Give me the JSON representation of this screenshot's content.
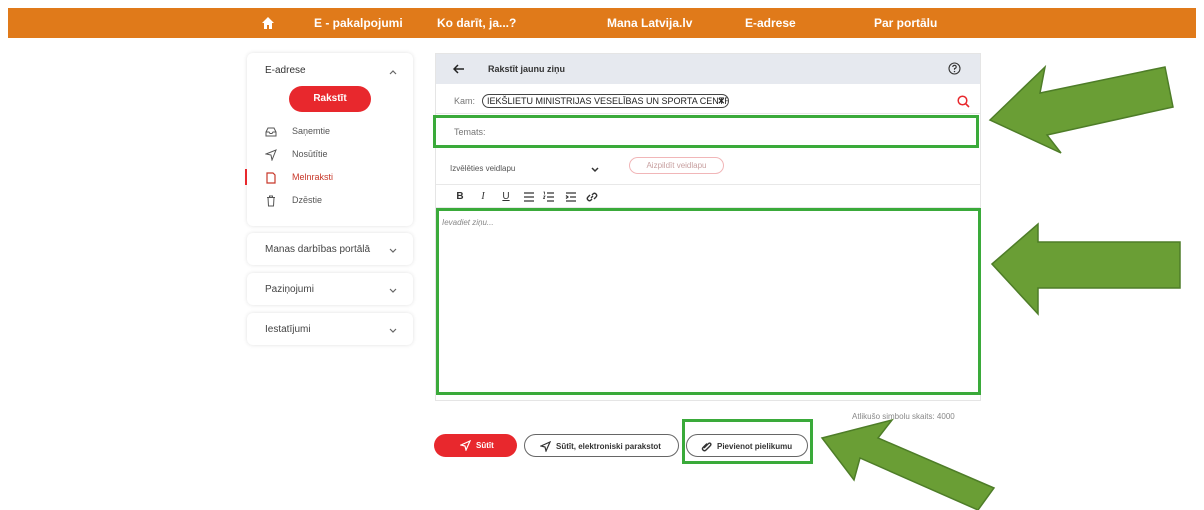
{
  "nav": {
    "home_icon": "home-icon",
    "items": [
      "E - pakalpojumi",
      "Ko darīt, ja...?",
      "Mana Latvija.lv",
      "E-adrese",
      "Par portālu"
    ]
  },
  "sidebar": {
    "section_title": "E-adrese",
    "write_button": "Rakstīt",
    "items": [
      {
        "label": "Saņemtie",
        "icon": "inbox-icon"
      },
      {
        "label": "Nosūtītie",
        "icon": "send-icon"
      },
      {
        "label": "Melnraksti",
        "icon": "draft-icon"
      },
      {
        "label": "Dzēstie",
        "icon": "trash-icon"
      }
    ],
    "collapsed": [
      "Manas darbības portālā",
      "Paziņojumi",
      "Iestatījumi"
    ]
  },
  "composer": {
    "title": "Rakstīt jaunu ziņu",
    "to_label": "Kam:",
    "recipient": "IEKŠLIETU MINISTRIJAS VESELĪBAS UN SPORTA CENTRS",
    "subject_placeholder": "Temats:",
    "template_select": "Izvēlēties veidlapu",
    "template_fill": "Aizpildīt veidlapu",
    "toolbar": [
      "B",
      "I",
      "U"
    ],
    "body_placeholder": "Ievadiet ziņu..."
  },
  "footer": {
    "counter": "Atlikušo simbolu skaits: 4000",
    "send": "Sūtīt",
    "send_signed": "Sūtīt, elektroniski parakstot",
    "attach": "Pievienot pielikumu"
  },
  "colors": {
    "nav": "#e07a1a",
    "accent_red": "#e8282d",
    "highlight_green": "#3aaa3a",
    "arrow_green": "#6a9e35"
  }
}
